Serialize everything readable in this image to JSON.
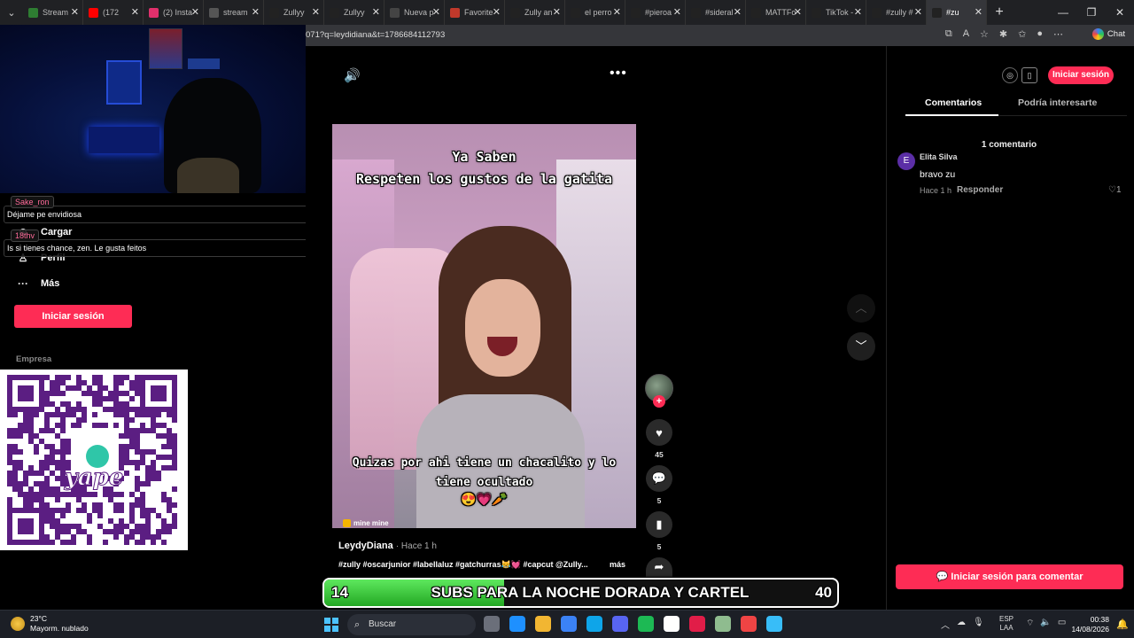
{
  "browser": {
    "tabs": [
      {
        "label": "Stream",
        "color": "#2e7d32"
      },
      {
        "label": "(172",
        "color": "#ff0000"
      },
      {
        "label": "(2) Insta",
        "color": "#e1306c"
      },
      {
        "label": "stream",
        "color": "#555555"
      },
      {
        "label": "Zullyy",
        "color": "#222222"
      },
      {
        "label": "Zullyy",
        "color": "#222222"
      },
      {
        "label": "Nueva p",
        "color": "#444444"
      },
      {
        "label": "Favorite",
        "color": "#c0392b"
      },
      {
        "label": "Zully an",
        "color": "#222222"
      },
      {
        "label": "el perro",
        "color": "#222222"
      },
      {
        "label": "#pieroa",
        "color": "#222222"
      },
      {
        "label": "#sideral",
        "color": "#222222"
      },
      {
        "label": "MATTFo",
        "color": "#222222"
      },
      {
        "label": "TikTok -",
        "color": "#222222"
      },
      {
        "label": "#zully #",
        "color": "#222222"
      },
      {
        "label": "#zu",
        "color": "#222222"
      }
    ],
    "address": "071?q=leydidiana&t=1786684112793",
    "chat_label": "Chat"
  },
  "sidebar": {
    "items": [
      {
        "icon": "upload-icon",
        "label": "Cargar"
      },
      {
        "icon": "profile-icon",
        "label": "Perfil"
      },
      {
        "icon": "more-icon",
        "label": "Más"
      }
    ],
    "login": "Iniciar sesión",
    "empresa": "Empresa"
  },
  "chat_overlay": {
    "messages": [
      {
        "user": "Sake_ron",
        "text": "Déjame pe envidiosa",
        "user_color": "#ff6b9a"
      },
      {
        "user": "18thv",
        "text": "Is si tienes chance, zen. Le gusta feitos",
        "user_color": "#ff6b9a"
      }
    ]
  },
  "qr": {
    "brand": "yape"
  },
  "video": {
    "caption_top_1": "Ya Saben",
    "caption_top_2": "Respeten los gustos de la gatita",
    "caption_bottom_1": "Quizas por ahi tiene un chacalito y lo",
    "caption_bottom_2": "tiene ocultado",
    "caption_emojis": "😍💗🥕",
    "tag": "mine mine",
    "likes": "45",
    "comments": "5",
    "saves": "5",
    "author": "LeydyDiana",
    "time": "· Hace 1 h",
    "hashtags": "#zully #oscarjunior #labellaluz #gatchurras😹💓 #capcut @Zully...",
    "more": "más"
  },
  "comments_panel": {
    "login": "Iniciar sesión",
    "tab_comments": "Comentarios",
    "tab_interest": "Podría interesarte",
    "count": "1 comentario",
    "comment": {
      "initial": "E",
      "name": "Elita Silva",
      "text": "bravo zu",
      "time": "Hace 1 h",
      "reply": "Responder",
      "likes": "1"
    },
    "comment_button": "Iniciar sesión para comentar"
  },
  "goal": {
    "current": "14",
    "target": "40",
    "label": "SUBS PARA LA NOCHE DORADA Y CARTEL",
    "progress": 0.35
  },
  "taskbar": {
    "temp": "23°C",
    "weather": "Mayorm. nublado",
    "search": "Buscar",
    "lang_1": "ESP",
    "lang_2": "LAA",
    "time": "00:38",
    "date": "14/08/2026",
    "app_colors": [
      "#6b6f7a",
      "#1e90ff",
      "#f2b632",
      "#3b82f6",
      "#0ea5e9",
      "#5865f2",
      "#1db954",
      "#ffffff",
      "#e11d48",
      "#8fbc8f",
      "#ef4444",
      "#38bdf8"
    ]
  }
}
